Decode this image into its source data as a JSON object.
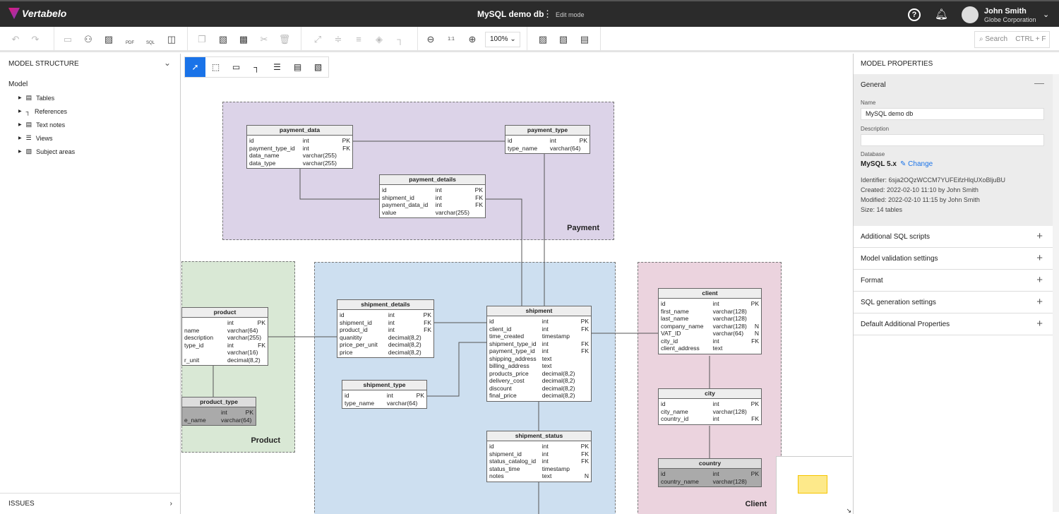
{
  "header": {
    "app": "Vertabelo",
    "title": "MySQL demo db",
    "mode": "Edit mode",
    "user": {
      "name": "John Smith",
      "company": "Globe Corporation"
    }
  },
  "toolbar": {
    "zoom": "100%",
    "search_placeholder": "Search",
    "search_shortcut": "CTRL + F",
    "icons": [
      "undo",
      "redo",
      "save",
      "share",
      "export-image",
      "export-pdf",
      "export-sql",
      "sidebar",
      "copy",
      "paste",
      "paste-format",
      "cut",
      "delete",
      "autolayout",
      "align",
      "distribute",
      "layers",
      "line-style",
      "zoom-out",
      "zoom-reset",
      "zoom-in",
      "subject-area-left",
      "subject-area-right",
      "subject-area-top"
    ],
    "pdf": "PDF",
    "sql": "SQL",
    "reset": "1:1"
  },
  "left": {
    "title": "MODEL STRUCTURE",
    "root": "Model",
    "items": [
      "Tables",
      "References",
      "Text notes",
      "Views",
      "Subject areas"
    ],
    "issues": "ISSUES"
  },
  "areas": [
    {
      "label": "Payment",
      "color": "#dcd3e8"
    },
    {
      "label": "Product",
      "color": "#d9e8d5"
    },
    {
      "label": "",
      "color": "#cddff0"
    },
    {
      "label": "Client",
      "color": "#ebd3de"
    }
  ],
  "tables": [
    {
      "name": "payment_data",
      "rows": [
        [
          "id",
          "int",
          "PK"
        ],
        [
          "payment_type_id",
          "int",
          "FK"
        ],
        [
          "data_name",
          "varchar(255)",
          ""
        ],
        [
          "data_type",
          "varchar(255)",
          ""
        ]
      ]
    },
    {
      "name": "payment_type",
      "rows": [
        [
          "id",
          "int",
          "PK"
        ],
        [
          "type_name",
          "varchar(64)",
          ""
        ]
      ]
    },
    {
      "name": "payment_details",
      "rows": [
        [
          "id",
          "int",
          "PK"
        ],
        [
          "shipment_id",
          "int",
          "FK"
        ],
        [
          "payment_data_id",
          "int",
          "FK"
        ],
        [
          "value",
          "varchar(255)",
          ""
        ]
      ]
    },
    {
      "name": "product",
      "rows": [
        [
          "",
          "int",
          "PK"
        ],
        [
          "name",
          "varchar(64)",
          ""
        ],
        [
          "description",
          "varchar(255)",
          ""
        ],
        [
          "type_id",
          "int",
          "FK"
        ],
        [
          "",
          "varchar(16)",
          ""
        ],
        [
          "r_unit",
          "decimal(8,2)",
          ""
        ]
      ]
    },
    {
      "name": "product_type",
      "rows": [
        [
          "",
          "int",
          "PK"
        ],
        [
          "e_name",
          "varchar(64)",
          ""
        ]
      ]
    },
    {
      "name": "shipment_details",
      "rows": [
        [
          "id",
          "int",
          "PK"
        ],
        [
          "shipment_id",
          "int",
          "FK"
        ],
        [
          "product_id",
          "int",
          "FK"
        ],
        [
          "quanitity",
          "decimal(8,2)",
          ""
        ],
        [
          "price_per_unit",
          "decimal(8,2)",
          ""
        ],
        [
          "price",
          "decimal(8,2)",
          ""
        ]
      ]
    },
    {
      "name": "shipment_type",
      "rows": [
        [
          "id",
          "int",
          "PK"
        ],
        [
          "type_name",
          "varchar(64)",
          ""
        ]
      ]
    },
    {
      "name": "shipment",
      "rows": [
        [
          "id",
          "int",
          "PK"
        ],
        [
          "client_id",
          "int",
          "FK"
        ],
        [
          "time_created",
          "timestamp",
          ""
        ],
        [
          "shipment_type_id",
          "int",
          "FK"
        ],
        [
          "payment_type_id",
          "int",
          "FK"
        ],
        [
          "shipping_address",
          "text",
          ""
        ],
        [
          "billing_address",
          "text",
          ""
        ],
        [
          "products_price",
          "decimal(8,2)",
          ""
        ],
        [
          "delivery_cost",
          "decimal(8,2)",
          ""
        ],
        [
          "discount",
          "decimal(8,2)",
          ""
        ],
        [
          "final_price",
          "decimal(8,2)",
          ""
        ]
      ]
    },
    {
      "name": "shipment_status",
      "rows": [
        [
          "id",
          "int",
          "PK"
        ],
        [
          "shipment_id",
          "int",
          "FK"
        ],
        [
          "status_catalog_id",
          "int",
          "FK"
        ],
        [
          "status_time",
          "timestamp",
          ""
        ],
        [
          "notes",
          "text",
          "N"
        ]
      ]
    },
    {
      "name": "client",
      "rows": [
        [
          "id",
          "int",
          "PK"
        ],
        [
          "first_name",
          "varchar(128)",
          ""
        ],
        [
          "last_name",
          "varchar(128)",
          ""
        ],
        [
          "company_name",
          "varchar(128)",
          "N"
        ],
        [
          "VAT_ID",
          "varchar(64)",
          "N"
        ],
        [
          "city_id",
          "int",
          "FK"
        ],
        [
          "client_address",
          "text",
          ""
        ]
      ]
    },
    {
      "name": "city",
      "rows": [
        [
          "id",
          "int",
          "PK"
        ],
        [
          "city_name",
          "varchar(128)",
          ""
        ],
        [
          "country_id",
          "int",
          "FK"
        ]
      ]
    },
    {
      "name": "country",
      "rows": [
        [
          "id",
          "int",
          "PK"
        ],
        [
          "country_name",
          "varchar(128)",
          ""
        ]
      ]
    }
  ],
  "right": {
    "title": "MODEL PROPERTIES",
    "general": "General",
    "name_label": "Name",
    "name_value": "MySQL demo db",
    "desc_label": "Description",
    "desc_value": "",
    "db_label": "Database",
    "db_value": "MySQL 5.x",
    "change": "Change",
    "identifier": "Identifier: 6sja2OQzWCCM7YUFEifzHlqUXoBljuBU",
    "created": "Created: 2022-02-10 11:10 by John Smith",
    "modified": "Modified: 2022-02-10 11:15 by John Smith",
    "size": "Size: 14 tables",
    "sections": [
      "Additional SQL scripts",
      "Model validation settings",
      "Format",
      "SQL generation settings",
      "Default Additional Properties"
    ]
  }
}
